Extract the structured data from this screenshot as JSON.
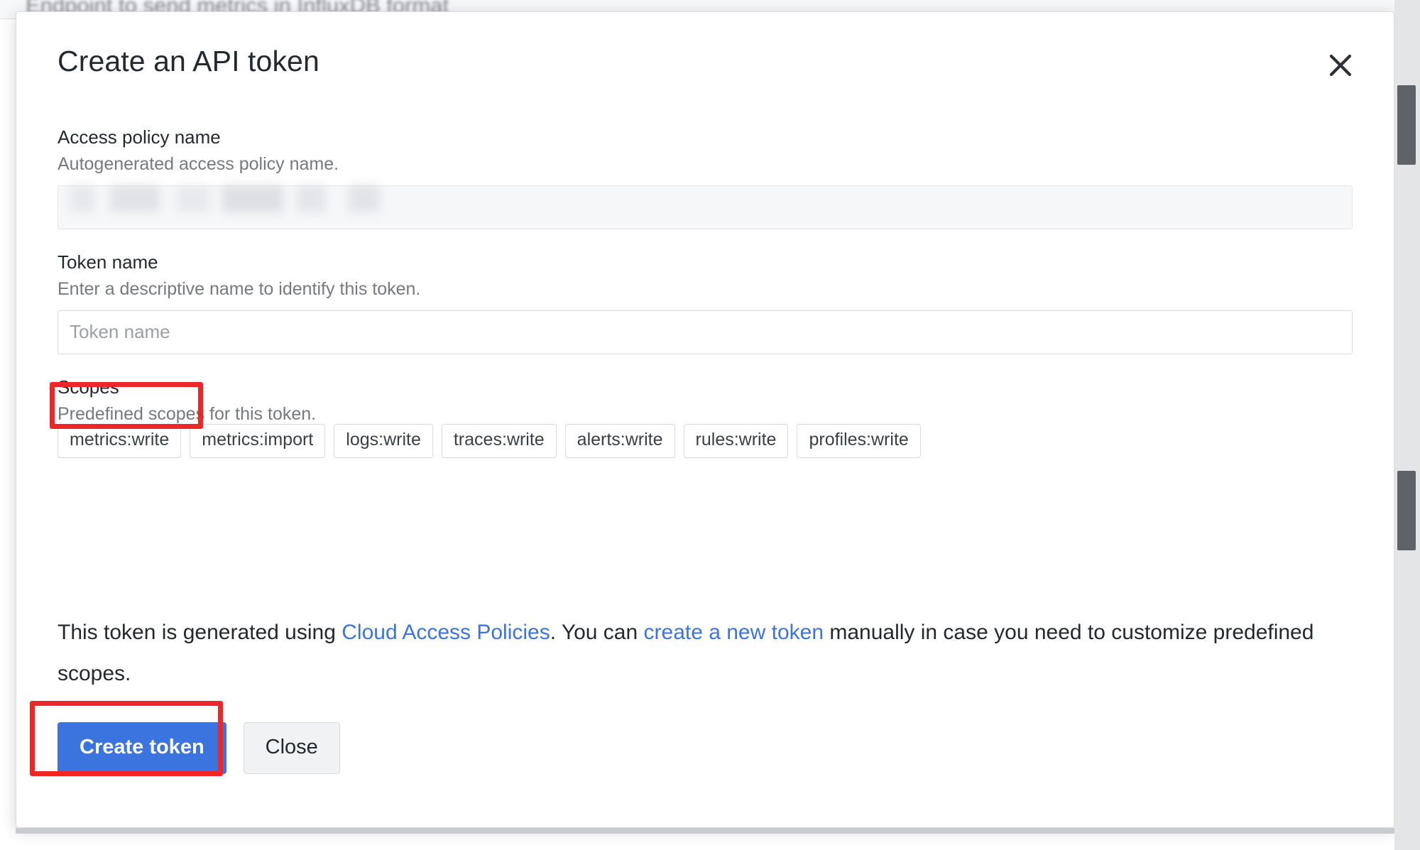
{
  "background": {
    "page_text": "Endpoint to send metrics in InfluxDB format"
  },
  "modal": {
    "title": "Create an API token",
    "close_icon": "close-icon",
    "fields": {
      "access_policy": {
        "label": "Access policy name",
        "help": "Autogenerated access policy name.",
        "value": "",
        "placeholder": "",
        "redacted": true
      },
      "token_name": {
        "label": "Token name",
        "help": "Enter a descriptive name to identify this token.",
        "value": "",
        "placeholder": "Token name"
      },
      "scopes": {
        "label": "Scopes",
        "help": "Predefined scopes for this token.",
        "chips": [
          "metrics:write",
          "metrics:import",
          "logs:write",
          "traces:write",
          "alerts:write",
          "rules:write",
          "profiles:write"
        ]
      }
    },
    "note": {
      "part1": "This token is generated using ",
      "link1": "Cloud Access Policies",
      "part2": ". You can ",
      "link2": "create a new token",
      "part3": " manually in case you need to customize predefined scopes."
    },
    "buttons": {
      "primary": "Create token",
      "secondary": "Close"
    }
  },
  "annotations": {
    "highlight_color": "#ef2626",
    "highlighted": [
      "token-name-input",
      "create-token-button"
    ]
  },
  "colors": {
    "primary_button": "#3b73df",
    "link": "#3b73df",
    "highlight": "#ef2626",
    "text": "#24292e",
    "muted_text": "#76797e"
  }
}
